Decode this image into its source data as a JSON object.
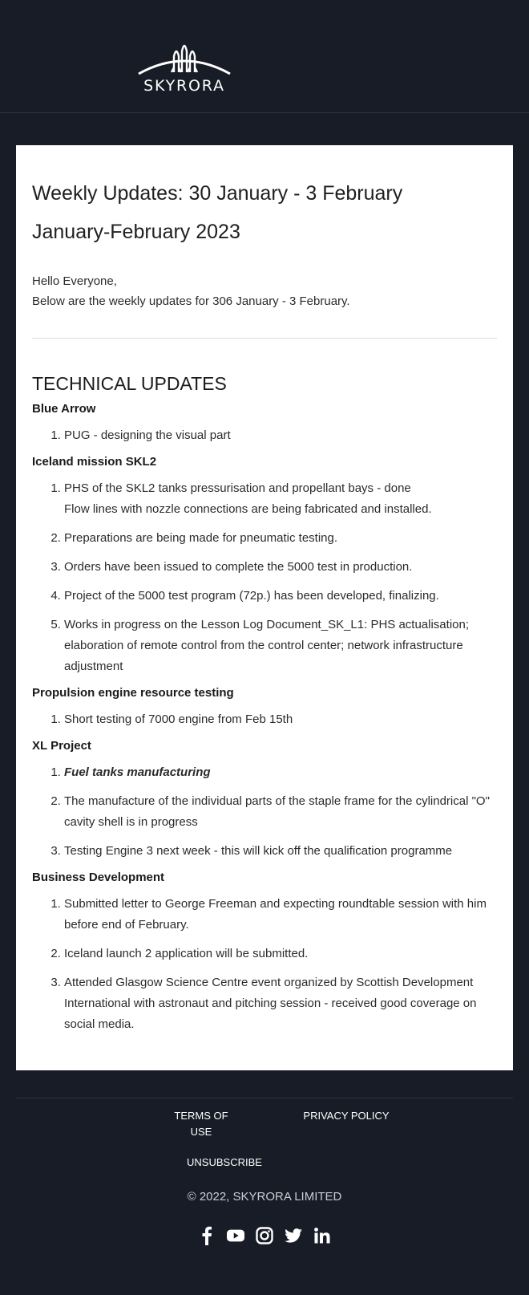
{
  "header": {
    "brand": "SKYRORA"
  },
  "content": {
    "title": "Weekly Updates: 30 January - 3 February",
    "subtitle": "January-February 2023",
    "greeting": "Hello Everyone,",
    "intro": "Below are the weekly updates for 306 January - 3 February.",
    "section_heading": "TECHNICAL UPDATES",
    "groups": [
      {
        "title": "Blue Arrow",
        "items": [
          "PUG - designing the visual part"
        ]
      },
      {
        "title": "Iceland mission SKL2",
        "items": [
          "PHS of the SKL2 tanks pressurisation and propellant bays - done",
          "Preparations are being made for pneumatic testing.",
          "Orders have been issued to complete the 5000 test in production.",
          "Project of the 5000 test program (72p.) has been developed, finalizing.",
          "Works in progress on the Lesson Log Document_SK_L1: PHS actualisation; elaboration of remote control from the control center; network infrastructure adjustment"
        ],
        "item1_subline": "Flow lines with nozzle connections are being fabricated and installed."
      },
      {
        "title": "Propulsion engine resource testing",
        "items": [
          "Short testing of 7000 engine from Feb 15th"
        ]
      },
      {
        "title": "XL Project",
        "items": [
          "Fuel tanks manufacturing",
          "The manufacture of the individual parts of the staple frame for the cylindrical \"O\" cavity shell is in progress",
          "Testing Engine 3 next week - this will kick off the qualification programme"
        ]
      },
      {
        "title": "Business Development",
        "items": [
          "Submitted letter to George Freeman and expecting roundtable session with him before end of February.",
          "Iceland launch 2 application will be submitted.",
          "Attended Glasgow Science Centre event organized by Scottish Development International with astronaut and pitching session - received good coverage on social media."
        ]
      }
    ]
  },
  "footer": {
    "terms": "TERMS OF USE",
    "privacy": "PRIVACY POLICY",
    "unsubscribe": "UNSUBSCRIBE",
    "copyright": "© 2022, SKYRORA LIMITED",
    "social_icons": [
      "facebook-icon",
      "youtube-icon",
      "instagram-icon",
      "twitter-icon",
      "linkedin-icon"
    ]
  }
}
